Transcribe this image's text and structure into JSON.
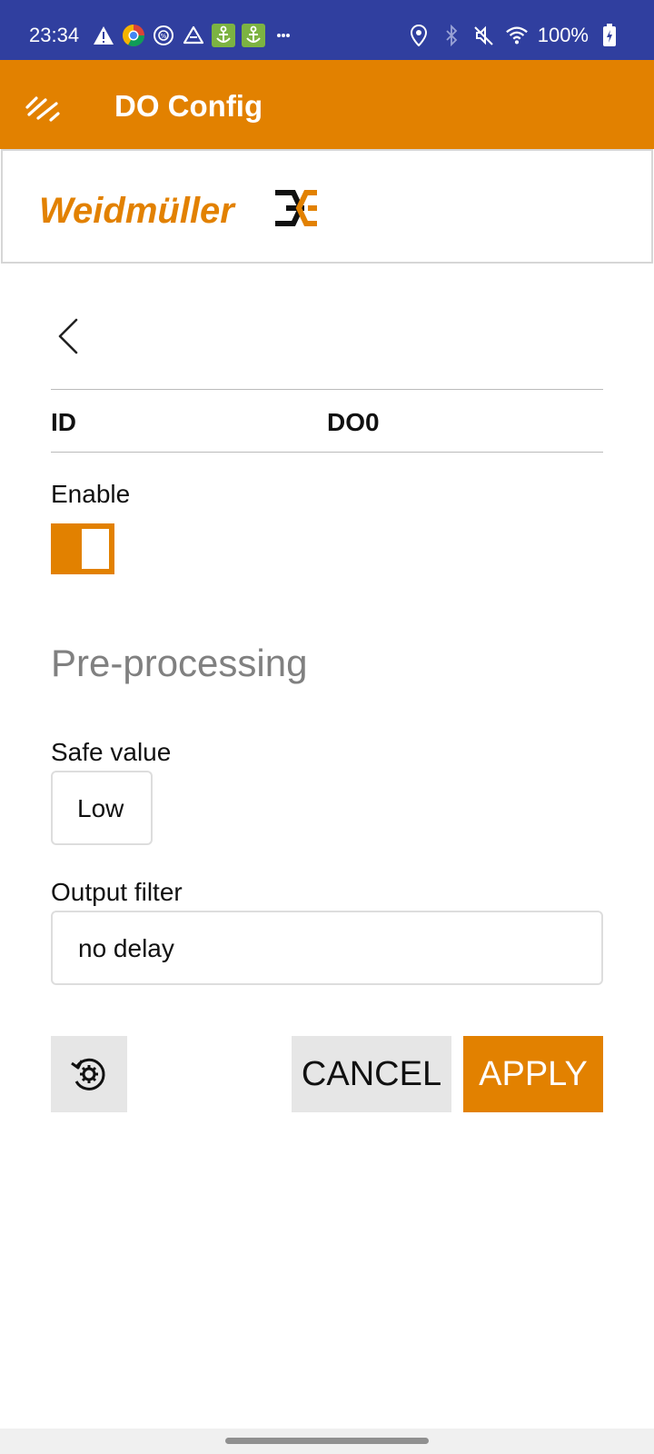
{
  "status_bar": {
    "time": "23:34",
    "battery": "100%",
    "left_icons": [
      "alert-icon",
      "chrome-icon",
      "vpn-icon",
      "drive-icon",
      "anchor-icon",
      "anchor-icon",
      "more-icon"
    ],
    "right_icons": [
      "location-icon",
      "bluetooth-icon",
      "mute-icon",
      "wifi-icon",
      "battery-icon"
    ],
    "color": "#303f9f"
  },
  "app_bar": {
    "title": "DO Config",
    "menu_icon": "menu-icon",
    "color": "#e28100"
  },
  "logo": {
    "text": "Weidmüller",
    "mark_icon": "weidmuller-logo-mark"
  },
  "config": {
    "id_label": "ID",
    "id_value": "DO0",
    "enable_label": "Enable",
    "enable_state": true,
    "section_title": "Pre-processing",
    "safe_value_label": "Safe value",
    "safe_value": "Low",
    "output_filter_label": "Output filter",
    "output_filter_value": "no delay"
  },
  "actions": {
    "cancel_label": "CANCEL",
    "apply_label": "APPLY",
    "reset_icon": "reset-settings-icon"
  },
  "accent_color": "#e28100"
}
